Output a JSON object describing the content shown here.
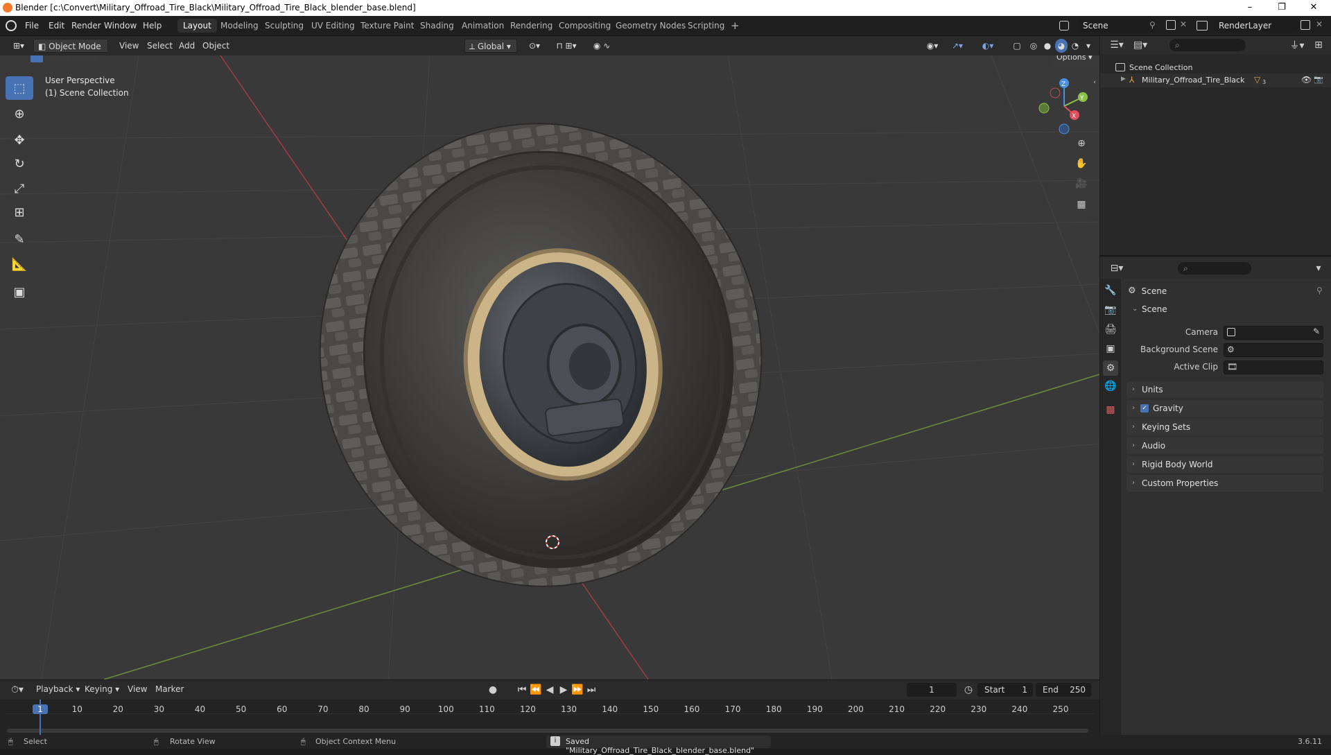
{
  "titlebar": {
    "title": "Blender [c:\\Convert\\Military_Offroad_Tire_Black\\Military_Offroad_Tire_Black_blender_base.blend]",
    "minimize": "–",
    "maximize": "❐",
    "close": "✕"
  },
  "menus": [
    "File",
    "Edit",
    "Render",
    "Window",
    "Help"
  ],
  "workspaces": [
    "Layout",
    "Modeling",
    "Sculpting",
    "UV Editing",
    "Texture Paint",
    "Shading",
    "Animation",
    "Rendering",
    "Compositing",
    "Geometry Nodes",
    "Scripting"
  ],
  "active_workspace": "Layout",
  "add_workspace": "+",
  "scene_selector": "Scene",
  "view_layer": "RenderLayer",
  "viewport_header": {
    "mode": "Object Mode",
    "menus": [
      "View",
      "Select",
      "Add",
      "Object"
    ],
    "transform_orientation": "Global",
    "options": "Options"
  },
  "viewport": {
    "perspective": "User Perspective",
    "collection": "(1) Scene Collection",
    "axis_x": "X",
    "axis_y": "Y",
    "axis_z": "Z"
  },
  "outliner": {
    "root": "Scene Collection",
    "items": [
      {
        "name": "Military_Offroad_Tire_Black",
        "badge": "3"
      }
    ]
  },
  "properties": {
    "header": "Scene",
    "panel": "Scene",
    "fields": {
      "camera": "Camera",
      "background_scene": "Background Scene",
      "active_clip": "Active Clip"
    },
    "sections": [
      "Units",
      "Gravity",
      "Keying Sets",
      "Audio",
      "Rigid Body World",
      "Custom Properties"
    ],
    "gravity_checked": true
  },
  "timeline": {
    "menus": [
      "Playback",
      "Keying",
      "View",
      "Marker"
    ],
    "current_frame": "1",
    "start_label": "Start",
    "start": "1",
    "end_label": "End",
    "end": "250",
    "ticks": [
      "1",
      "10",
      "20",
      "30",
      "40",
      "50",
      "60",
      "70",
      "80",
      "90",
      "100",
      "110",
      "120",
      "130",
      "140",
      "150",
      "160",
      "170",
      "180",
      "190",
      "200",
      "210",
      "220",
      "230",
      "240",
      "250"
    ]
  },
  "statusbar": {
    "select": "Select",
    "rotate": "Rotate View",
    "context": "Object Context Menu",
    "message": "Saved \"Military_Offroad_Tire_Black_blender_base.blend\"",
    "version": "3.6.11"
  },
  "colors": {
    "accent": "#4772b3",
    "axis_x": "#e54c5d",
    "axis_y": "#8bc34a",
    "axis_z": "#4a90e2"
  }
}
